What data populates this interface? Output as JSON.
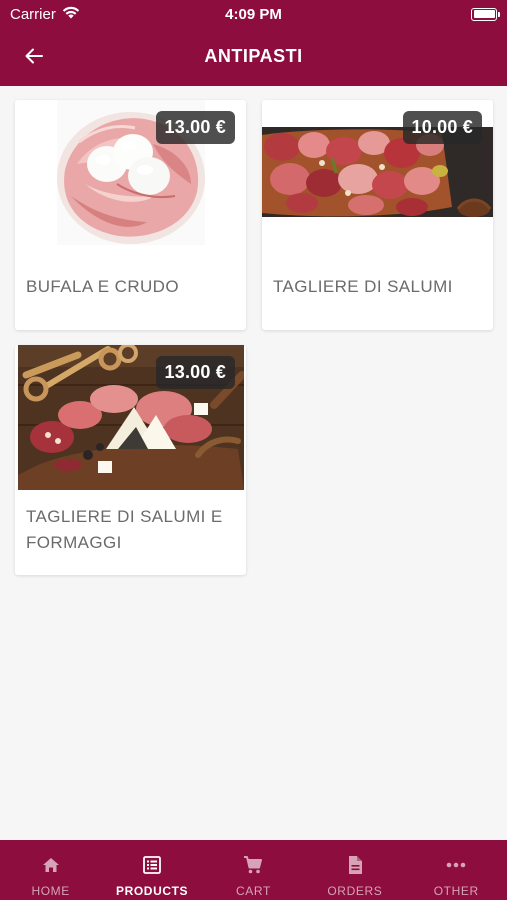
{
  "status": {
    "carrier": "Carrier",
    "time": "4:09 PM"
  },
  "header": {
    "title": "ANTIPASTI",
    "back_icon": "arrow-left-icon"
  },
  "products": [
    {
      "name": "BUFALA E CRUDO",
      "price": "13.00 €"
    },
    {
      "name": "TAGLIERE DI SALUMI",
      "price": "10.00 €"
    },
    {
      "name": "TAGLIERE DI SALUMI E FORMAGGI",
      "price": "13.00 €"
    }
  ],
  "tabbar": {
    "items": [
      {
        "label": "HOME",
        "icon": "home-icon"
      },
      {
        "label": "PRODUCTS",
        "icon": "list-icon",
        "active": true
      },
      {
        "label": "CART",
        "icon": "cart-icon"
      },
      {
        "label": "ORDERS",
        "icon": "document-icon"
      },
      {
        "label": "OTHER",
        "icon": "more-icon"
      }
    ]
  },
  "colors": {
    "brand": "#8c0d3e",
    "background": "#f6f6f6",
    "price_badge": "#2b2b2b"
  }
}
